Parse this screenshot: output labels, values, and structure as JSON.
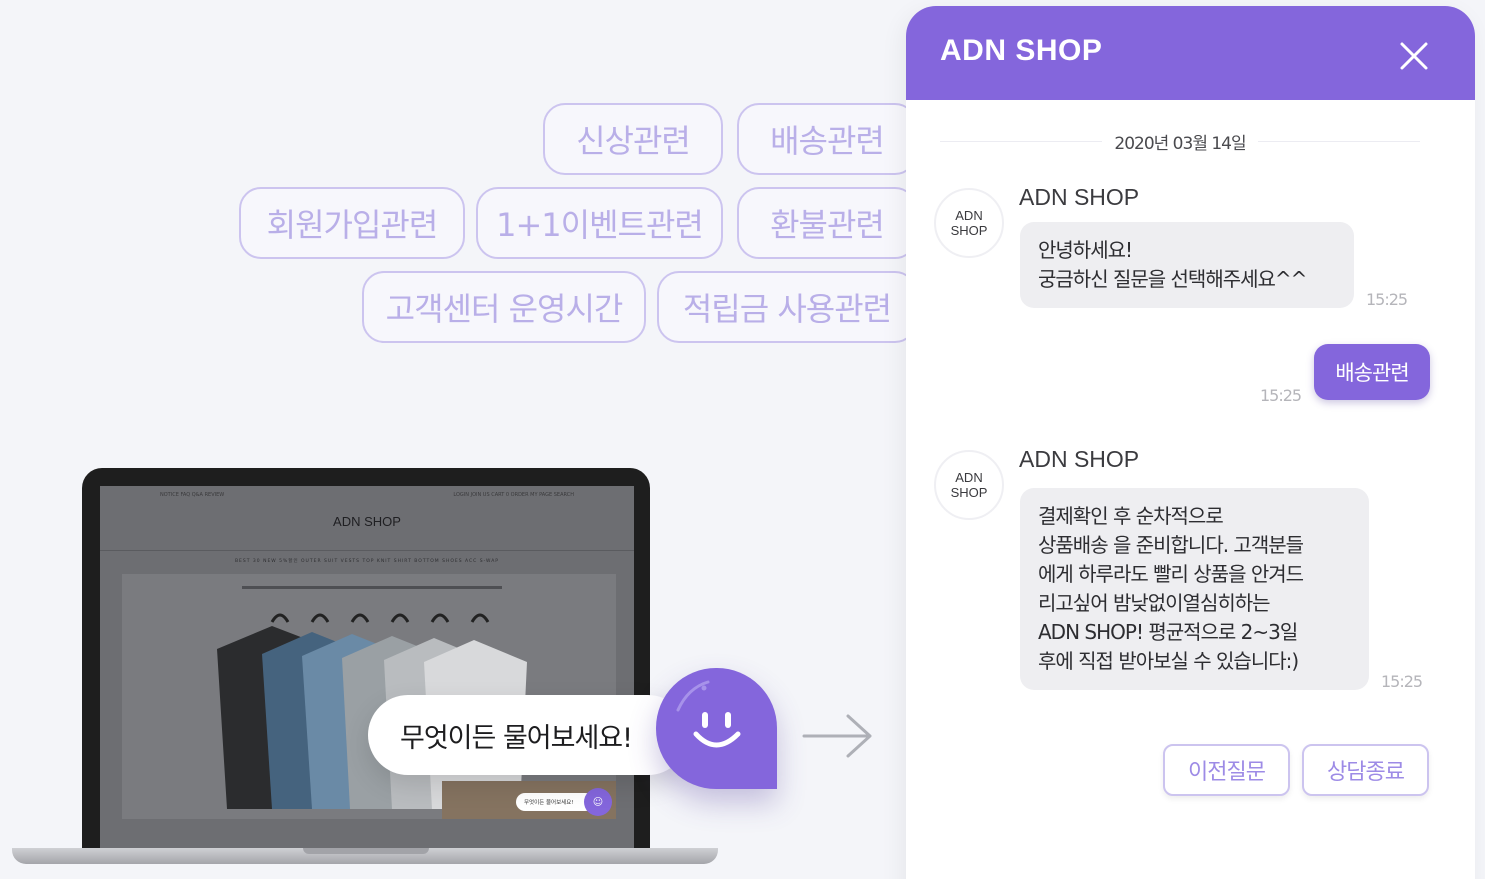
{
  "chips": {
    "new_items": "신상관련",
    "shipping": "배송관련",
    "signup": "회원가입관련",
    "one_plus_one": "1+1이벤트관련",
    "refund": "환불관련",
    "cs_hours": "고객센터 운영시간",
    "points": "적립금 사용관련"
  },
  "laptop": {
    "nav_left": "NOTICE  FAQ  Q&A  REVIEW",
    "nav_right": "LOGIN  JOIN US  CART 0  ORDER  MY PAGE  SEARCH",
    "brand": "ADN SHOP",
    "menu": "BEST 30   NEW 5%할인   OUTER   SUIT   VESTS   TOP   KNIT   SHIRT   BOTTOM   SHOES   ACC   S-WAP",
    "mini_chat": "무엇이든 물어보세요!"
  },
  "ask_bubble": "무엇이든 물어보세요!",
  "chat": {
    "title": "ADN SHOP",
    "date": "2020년 03월 14일",
    "avatar_text": "ADN SHOP",
    "sender": "ADN SHOP",
    "msg1_line1": "안녕하세요!",
    "msg1_line2": "궁금하신 질문을 선택해주세요^^",
    "msg1_time": "15:25",
    "reply": "배송관련",
    "reply_time": "15:25",
    "msg2_lines": [
      "결제확인 후 순차적으로",
      "상품배송 을 준비합니다. 고객분들",
      "에게 하루라도 빨리 상품을 안겨드",
      "리고싶어 밤낮없이열심히하는",
      "ADN SHOP!  평균적으로 2~3일",
      "후에 직접 받아보실 수 있습니다:)"
    ],
    "msg2_time": "15:25",
    "prev_button": "이전질문",
    "end_button": "상담종료"
  },
  "colors": {
    "accent": "#8466dc",
    "chip_border": "#ccc4ef",
    "chip_text": "#b9afe8",
    "bubble_gray": "#eeeef1"
  }
}
